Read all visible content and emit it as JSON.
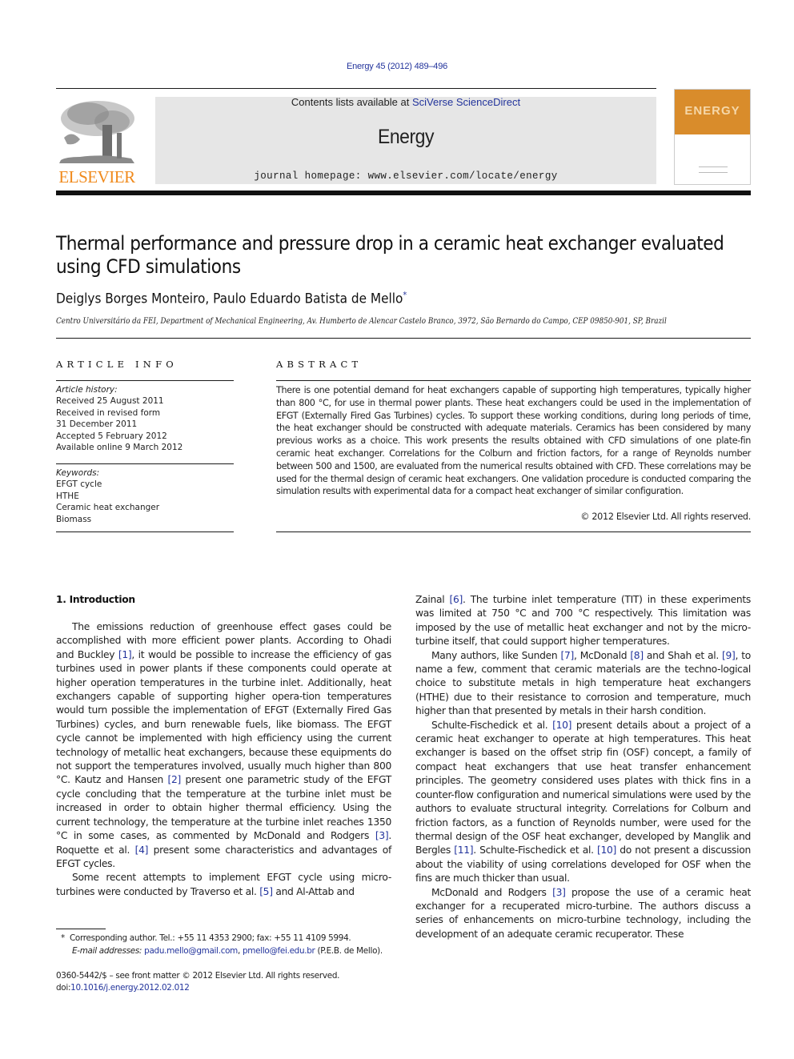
{
  "header": {
    "citation": "Energy 45 (2012) 489–496",
    "contents_prefix": "Contents lists available at ",
    "contents_link": "SciVerse ScienceDirect",
    "journal_name": "Energy",
    "homepage": "journal homepage: www.elsevier.com/locate/energy",
    "publisher_logo_text": "ELSEVIER",
    "cover_title": "ENERGY",
    "colors": {
      "publisher_orange": "#f08a1c",
      "cover_orange": "#d98c2b",
      "link_blue": "#23349c",
      "masthead_gray": "#e6e6e6"
    }
  },
  "article": {
    "title": "Thermal performance and pressure drop in a ceramic heat exchanger evaluated using CFD simulations",
    "authors": "Deiglys Borges Monteiro, Paulo Eduardo Batista de Mello",
    "corresponding_mark": "*",
    "affiliation": "Centro Universitário da FEI, Department of Mechanical Engineering, Av. Humberto de Alencar Castelo Branco, 3972, São Bernardo do Campo, CEP 09850-901, SP, Brazil"
  },
  "article_info": {
    "heading": "ARTICLE INFO",
    "history_label": "Article history:",
    "history": [
      "Received 25 August 2011",
      "Received in revised form",
      "31 December 2011",
      "Accepted 5 February 2012",
      "Available online 9 March 2012"
    ],
    "keywords_label": "Keywords:",
    "keywords": [
      "EFGT cycle",
      "HTHE",
      "Ceramic heat exchanger",
      "Biomass"
    ]
  },
  "abstract": {
    "heading": "ABSTRACT",
    "text": "There is one potential demand for heat exchangers capable of supporting high temperatures, typically higher than 800 °C, for use in thermal power plants. These heat exchangers could be used in the implementation of EFGT (Externally Fired Gas Turbines) cycles. To support these working conditions, during long periods of time, the heat exchanger should be constructed with adequate materials. Ceramics has been considered by many previous works as a choice. This work presents the results obtained with CFD simulations of one plate-fin ceramic heat exchanger. Correlations for the Colburn and friction factors, for a range of Reynolds number between 500 and 1500, are evaluated from the numerical results obtained with CFD. These correlations may be used for the thermal design of ceramic heat exchangers. One validation procedure is conducted comparing the simulation results with experimental data for a compact heat exchanger of similar configuration.",
    "copyright": "© 2012 Elsevier Ltd. All rights reserved."
  },
  "body": {
    "intro_heading": "1.  Introduction",
    "left_p1": [
      {
        "t": "The emissions reduction of greenhouse effect gases could be accomplished with more efficient power plants. According to Ohadi and Buckley "
      },
      {
        "ref": "[1]"
      },
      {
        "t": ", it would be possible to increase the efficiency of gas turbines used in power plants if these components could operate at higher operation temperatures in the turbine inlet. Additionally, heat exchangers capable of supporting higher opera-tion temperatures would turn possible the implementation of EFGT (Externally Fired Gas Turbines) cycles, and burn renewable fuels, like biomass. The EFGT cycle cannot be implemented with high efficiency using the current technology of metallic heat exchangers, because these equipments do not support the temperatures involved, usually much higher than 800 °C. Kautz and Hansen "
      },
      {
        "ref": "[2]"
      },
      {
        "t": " present one parametric study of the EFGT cycle concluding that the temperature at the turbine inlet must be increased in order to obtain higher thermal efficiency. Using the current technology, the temperature at the turbine inlet reaches 1350 °C in some cases, as commented by McDonald and Rodgers "
      },
      {
        "ref": "[3]"
      },
      {
        "t": ". Roquette et al. "
      },
      {
        "ref": "[4]"
      },
      {
        "t": " present some characteristics and advantages of EFGT cycles."
      }
    ],
    "left_p2": [
      {
        "t": "Some recent attempts to implement EFGT cycle using micro-turbines were conducted by Traverso et al. "
      },
      {
        "ref": "[5]"
      },
      {
        "t": " and Al-Attab and"
      }
    ],
    "right_p1": [
      {
        "t": "Zainal "
      },
      {
        "ref": "[6]"
      },
      {
        "t": ". The turbine inlet temperature (TIT) in these experiments was limited at 750 °C and 700 °C respectively. This limitation was imposed by the use of metallic heat exchanger and not by the micro-turbine itself, that could support higher temperatures."
      }
    ],
    "right_p2": [
      {
        "t": "Many authors, like Sunden "
      },
      {
        "ref": "[7]"
      },
      {
        "t": ", McDonald "
      },
      {
        "ref": "[8]"
      },
      {
        "t": " and Shah et al. "
      },
      {
        "ref": "[9]"
      },
      {
        "t": ", to name a few, comment that ceramic materials are the techno-logical choice to substitute metals in high temperature heat exchangers (HTHE) due to their resistance to corrosion and temperature, much higher than that presented by metals in their harsh condition."
      }
    ],
    "right_p3": [
      {
        "t": "Schulte-Fischedick et al. "
      },
      {
        "ref": "[10]"
      },
      {
        "t": " present details about a project of a ceramic heat exchanger to operate at high temperatures. This heat exchanger is based on the offset strip fin (OSF) concept, a family of compact heat exchangers that use heat transfer enhancement principles. The geometry considered uses plates with thick fins in a counter-flow configuration and numerical simulations were used by the authors to evaluate structural integrity. Correlations for Colburn and friction factors, as a function of Reynolds number, were used for the thermal design of the OSF heat exchanger, developed by Manglik and Bergles "
      },
      {
        "ref": "[11]"
      },
      {
        "t": ". Schulte-Fischedick et al. "
      },
      {
        "ref": "[10]"
      },
      {
        "t": " do not present a discussion about the viability of using correlations developed for OSF when the fins are much thicker than usual."
      }
    ],
    "right_p4": [
      {
        "t": "McDonald and Rodgers "
      },
      {
        "ref": "[3]"
      },
      {
        "t": " propose the use of a ceramic heat exchanger for a recuperated micro-turbine. The authors discuss a series of enhancements on micro-turbine technology, including the development of an adequate ceramic recuperator. These"
      }
    ]
  },
  "footnote": {
    "mark": "*",
    "corresponding": "Corresponding author. Tel.: +55 11 4353 2900; fax: +55 11 4109 5994.",
    "email_label": "E-mail addresses:",
    "email1": "padu.mello@gmail.com",
    "sep": ", ",
    "email2": "pmello@fei.edu.br",
    "email_suffix": " (P.E.B. de Mello)."
  },
  "front_matter": {
    "issn": "0360-5442/$ – see front matter © 2012 Elsevier Ltd. All rights reserved.",
    "doi_label": "doi:",
    "doi": "10.1016/j.energy.2012.02.012"
  }
}
